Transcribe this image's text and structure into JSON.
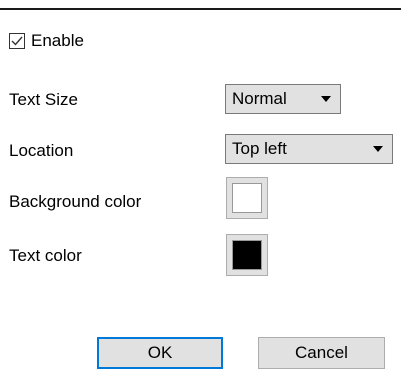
{
  "enable": {
    "label": "Enable",
    "checked": true
  },
  "text_size": {
    "label": "Text Size",
    "value": "Normal"
  },
  "location": {
    "label": "Location",
    "value": "Top left"
  },
  "background_color": {
    "label": "Background color",
    "color": "#ffffff"
  },
  "text_color": {
    "label": "Text color",
    "color": "#000000"
  },
  "buttons": {
    "ok": "OK",
    "cancel": "Cancel"
  },
  "colors": {
    "focus_border": "#0078d7",
    "control_bg": "#e1e1e1"
  }
}
